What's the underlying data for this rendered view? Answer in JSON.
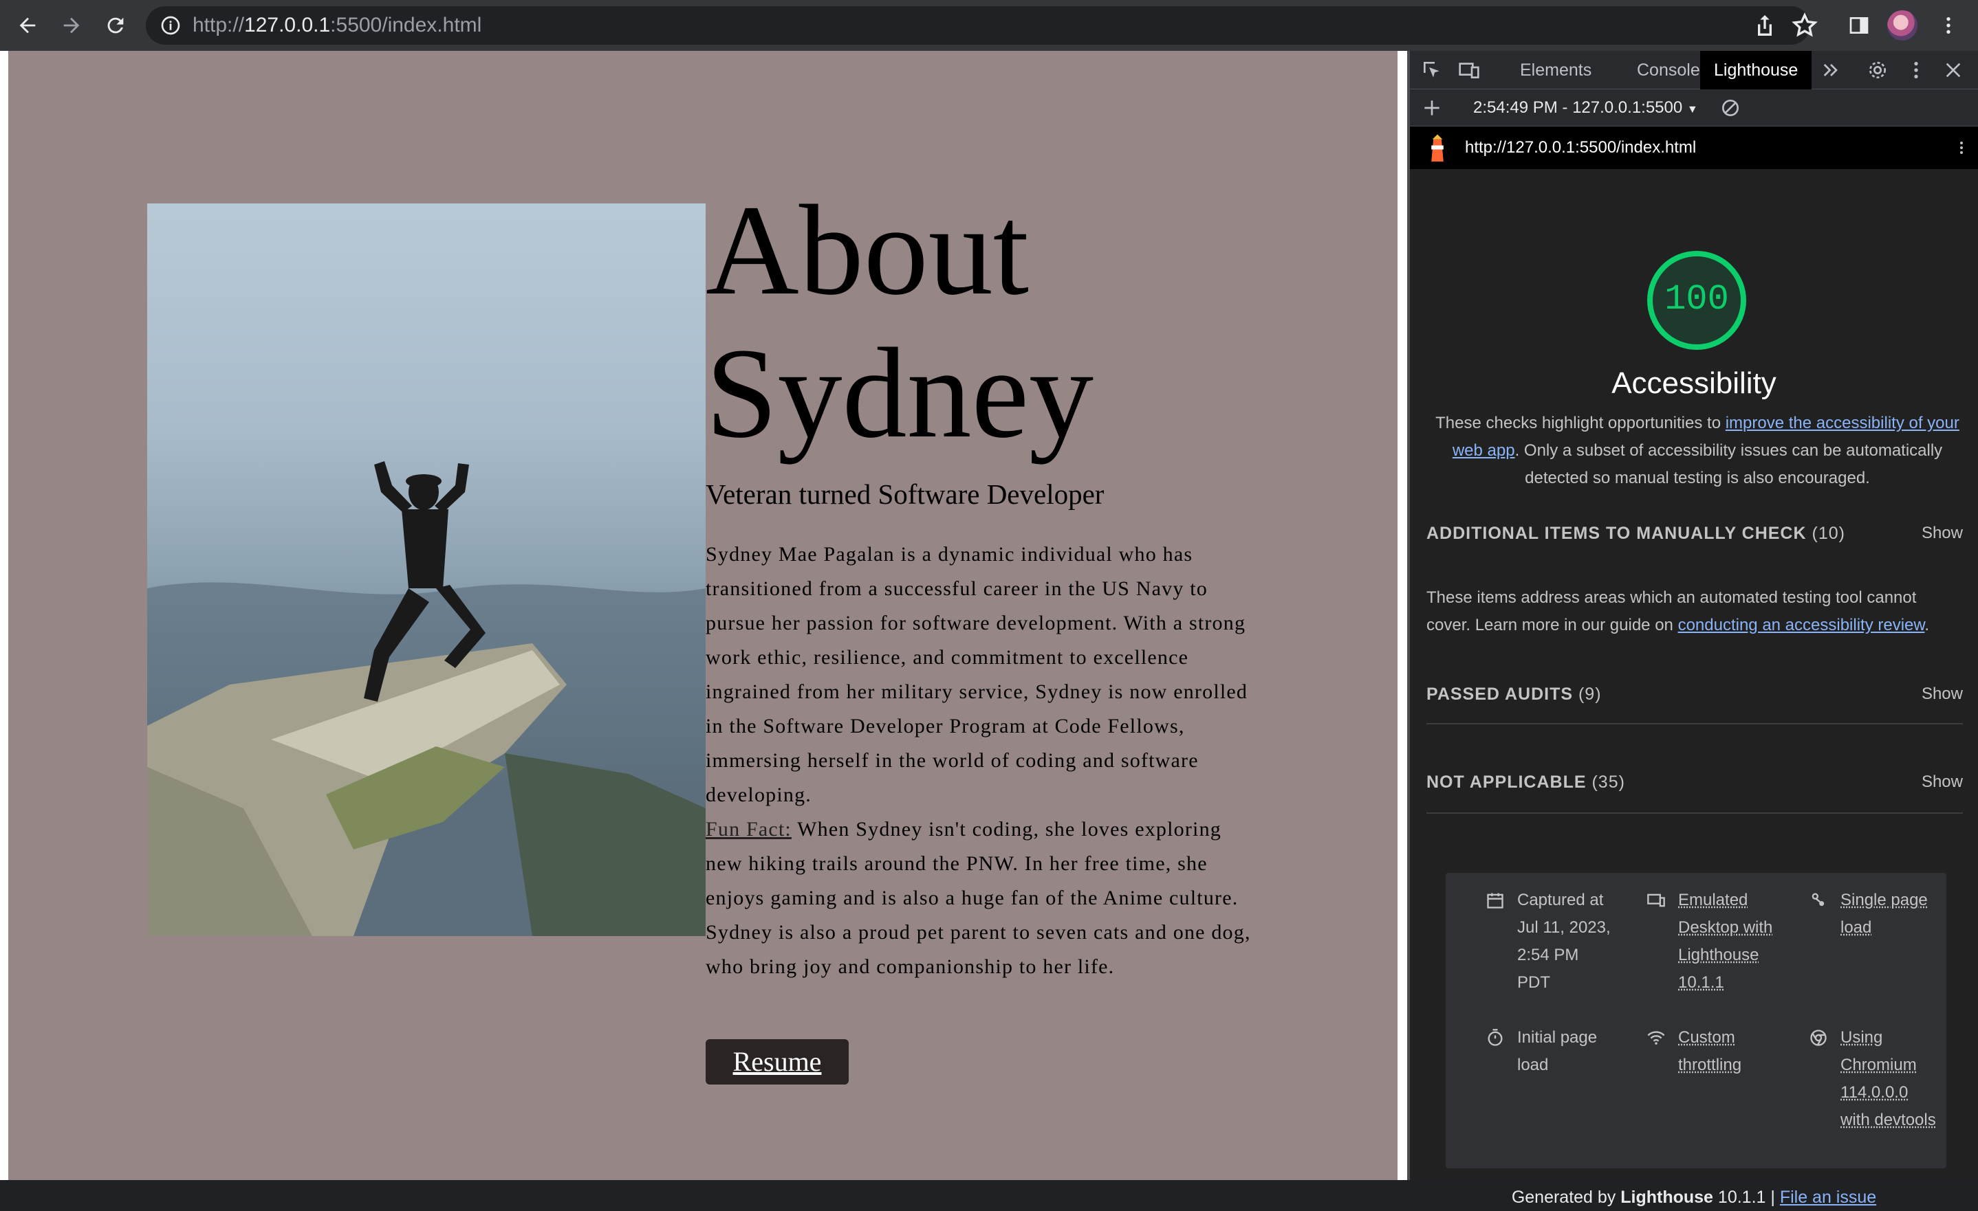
{
  "browser": {
    "url_scheme": "http://",
    "url_host": "127.0.0.1",
    "url_path": ":5500/index.html"
  },
  "page": {
    "title_line1": "About",
    "title_line2": "Sydney",
    "subtitle": "Veteran turned Software Developer",
    "bio_p1": "Sydney Mae Pagalan is a dynamic individual who has transitioned from a successful career in the US Navy to pursue her passion for software development. With a strong work ethic, resilience, and commitment to excellence ingrained from her military service, Sydney is now enrolled in the Software Developer Program at Code Fellows, immersing herself in the world of coding and software developing.",
    "fun_fact_label": "Fun Fact:",
    "bio_p2": " When Sydney isn't coding, she loves exploring new hiking trails around the PNW. In her free time, she enjoys gaming and is also a huge fan of the Anime culture.",
    "bio_p3": "Sydney is also a proud pet parent to seven cats and one dog, who bring joy and companionship to her life.",
    "resume_label": "Resume"
  },
  "devtools": {
    "tabs": [
      "Elements",
      "Console",
      "Lighthouse"
    ],
    "active_tab": "Lighthouse",
    "report_selector": "2:54:49 PM - 127.0.0.1:5500",
    "report_url": "http://127.0.0.1:5500/index.html",
    "score": "100",
    "category_title": "Accessibility",
    "category_desc_pre": "These checks highlight opportunities to ",
    "category_desc_link": "improve the accessibility of your web app",
    "category_desc_post": ". Only a subset of accessibility issues can be automatically detected so manual testing is also encouraged.",
    "manual_group_label": "ADDITIONAL ITEMS TO MANUALLY CHECK",
    "manual_group_count": "(10)",
    "manual_desc_pre": "These items address areas which an automated testing tool cannot cover. Learn more in our guide on ",
    "manual_desc_link": "conducting an accessibility review",
    "manual_desc_post": ".",
    "passed_label": "PASSED AUDITS",
    "passed_count": "(9)",
    "na_label": "NOT APPLICABLE",
    "na_count": "(35)",
    "show_label": "Show",
    "meta": {
      "captured": "Captured at Jul 11, 2023, 2:54 PM PDT",
      "emulated": "Emulated Desktop with Lighthouse 10.1.1",
      "single_page": "Single page load",
      "initial_load": "Initial page load",
      "throttling": "Custom throttling",
      "chromium": "Using Chromium 114.0.0.0 with devtools"
    },
    "footer_pre": "Generated by ",
    "footer_brand": "Lighthouse",
    "footer_version": " 10.1.1 | ",
    "footer_link": "File an issue"
  },
  "colors": {
    "page_bg": "#968686",
    "score_green": "#0cce6b",
    "link_blue": "#8ab4f8",
    "button_bg": "#2a2424"
  }
}
